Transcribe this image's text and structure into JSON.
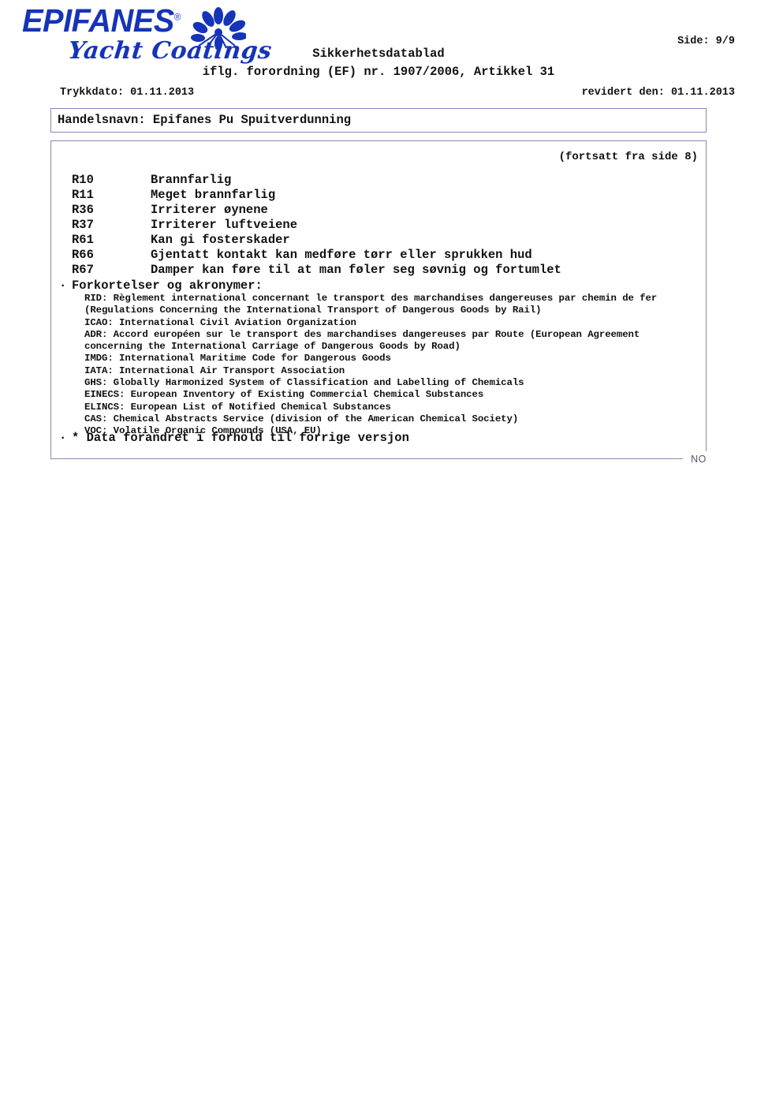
{
  "header": {
    "logo": {
      "wordmark": "EPIFANES",
      "registered_symbol": "®",
      "tagline": "Yacht Coatings",
      "fan_icon": "shell-fan-icon",
      "brand_color": "#1634b8"
    },
    "page_indicator": "Side: 9/9",
    "title": "Sikkerhetsdatablad",
    "subtitle": "iflg. forordning (EF) nr. 1907/2006, Artikkel 31",
    "print_date": "Trykkdato: 01.11.2013",
    "revised_date": "revidert den: 01.11.2013"
  },
  "trade_name": "Handelsnavn: Epifanes Pu Spuitverdunning",
  "content": {
    "continued_note": "(fortsatt fra side 8)",
    "r_phrases": [
      {
        "code": "R10",
        "text": "Brannfarlig"
      },
      {
        "code": "R11",
        "text": "Meget brannfarlig"
      },
      {
        "code": "R36",
        "text": "Irriterer øynene"
      },
      {
        "code": "R37",
        "text": "Irriterer luftveiene"
      },
      {
        "code": "R61",
        "text": "Kan gi fosterskader"
      },
      {
        "code": "R66",
        "text": "Gjentatt kontakt kan medføre tørr eller sprukken hud"
      },
      {
        "code": "R67",
        "text": "Damper kan føre til at man føler seg søvnig og fortumlet"
      }
    ],
    "bullet_marker": "·",
    "abbreviations_heading": "Forkortelser og akronymer:",
    "abbreviations": [
      "RID: Règlement international concernant le transport des marchandises dangereuses par chemin de fer",
      "(Regulations Concerning the International Transport of Dangerous Goods by Rail)",
      "ICAO: International Civil Aviation Organization",
      "ADR: Accord européen sur le transport des marchandises dangereuses par Route (European Agreement",
      "concerning the International Carriage of Dangerous Goods by Road)",
      "IMDG: International Maritime Code for Dangerous Goods",
      "IATA: International Air Transport Association",
      "GHS: Globally Harmonized System of Classification and Labelling of Chemicals",
      "EINECS: European Inventory of Existing Commercial Chemical Substances",
      "ELINCS: European List of Notified Chemical Substances",
      "CAS: Chemical Abstracts Service (division of the American Chemical Society)",
      "VOC: Volatile Organic Compounds (USA, EU)"
    ],
    "changed_data_note": "* Data forandret i forhold til forrige versjon"
  },
  "footer": {
    "locale_mark": "NO"
  },
  "colors": {
    "border": "#8888bb",
    "text": "#111111",
    "brand": "#1634b8",
    "locale_mark": "#555566"
  }
}
